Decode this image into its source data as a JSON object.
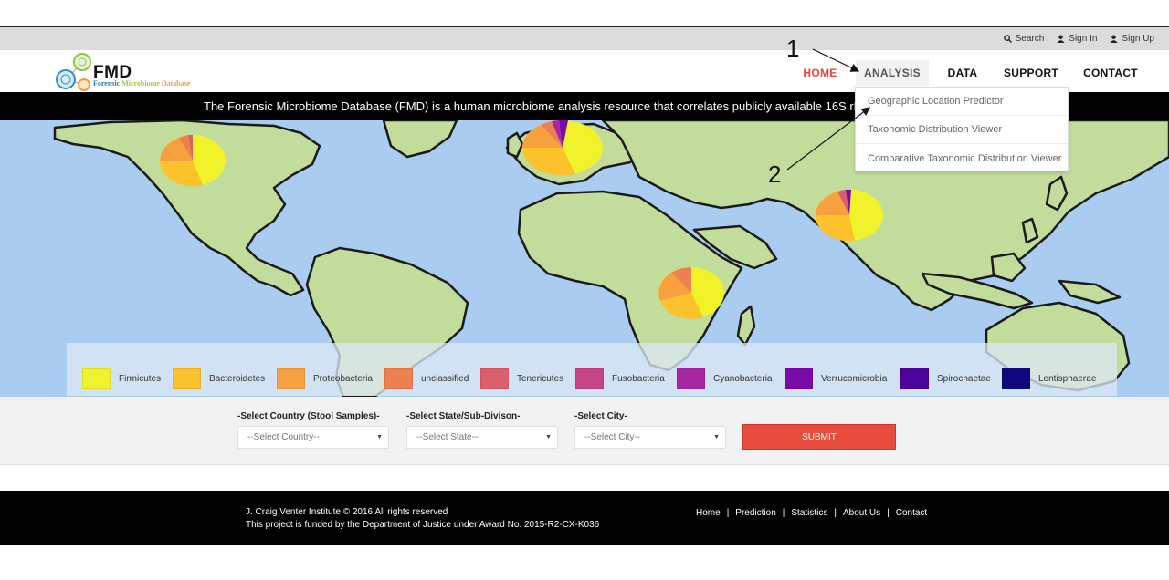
{
  "utility": {
    "search": "Search",
    "sign_in": "Sign In",
    "sign_up": "Sign Up"
  },
  "logo": {
    "title": "FMD",
    "sub_word1": "Forensic",
    "sub_word2": "Microbiome",
    "sub_word3": "Database"
  },
  "nav": {
    "home": "HOME",
    "analysis": "ANALYSIS",
    "data": "DATA",
    "support": "SUPPORT",
    "contact": "CONTACT"
  },
  "analysis_menu": [
    "Geographic Location Predictor",
    "Taxonomic Distribution Viewer",
    "Comparative Taxonomic Distribution Viewer"
  ],
  "banner": "The Forensic Microbiome Database (FMD) is a human microbiome analysis resource that correlates publicly available 16S rRNA s",
  "annotations": {
    "one": "1",
    "two": "2"
  },
  "legend": [
    {
      "label": "Firmicutes",
      "color": "#f2f22a"
    },
    {
      "label": "Bacteroidetes",
      "color": "#fbc22c"
    },
    {
      "label": "Proteobacteria",
      "color": "#f7a040"
    },
    {
      "label": "unclassified",
      "color": "#ee7f4e"
    },
    {
      "label": "Tenericutes",
      "color": "#dc5d6c"
    },
    {
      "label": "Fusobacteria",
      "color": "#c64385"
    },
    {
      "label": "Cyanobacteria",
      "color": "#a626a4"
    },
    {
      "label": "Verrucomicrobia",
      "color": "#7a0aa9"
    },
    {
      "label": "Spirochaetae",
      "color": "#4d039e"
    },
    {
      "label": "Lentisphaerae",
      "color": "#10077f"
    }
  ],
  "form": {
    "country_label": "-Select Country (Stool Samples)-",
    "country_value": "--Select Country--",
    "state_label": "-Select State/Sub-Divison-",
    "state_value": "--Select State--",
    "city_label": "-Select City-",
    "city_value": "--Select City--",
    "submit": "SUBMIT"
  },
  "footer": {
    "copyright": "J. Craig Venter Institute © 2016 All rights reserved",
    "funding": "This project is funded by the Department of Justice under Award No. 2015-R2-CX-K036",
    "links": [
      "Home",
      "Prediction",
      "Statistics",
      "About Us",
      "Contact"
    ]
  },
  "colors": {
    "accent": "#e84c3d",
    "ocean": "#a9ccf0",
    "land": "#c2dc9c"
  }
}
